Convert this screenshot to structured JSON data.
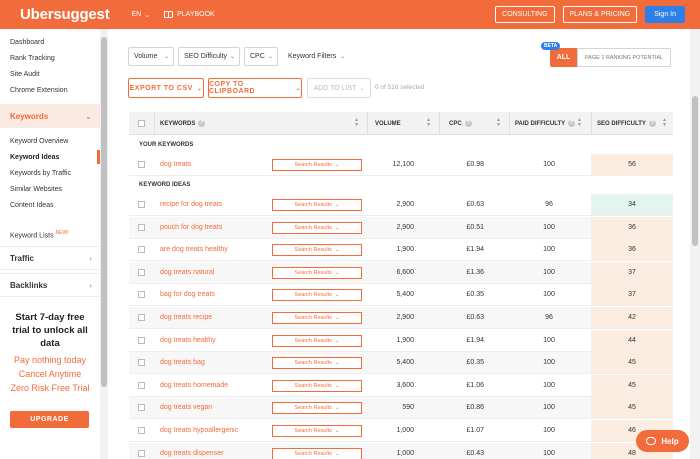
{
  "header": {
    "logo": "Ubersuggest",
    "lang": "EN",
    "playbook": "PLAYBOOK",
    "consulting": "CONSULTING",
    "plans": "PLANS & PRICING",
    "signin": "Sign In"
  },
  "sidebar": {
    "items": [
      "Dashboard",
      "Rank Tracking",
      "Site Audit",
      "Chrome Extension"
    ],
    "keywords_section": "Keywords",
    "sub_items": [
      "Keyword Overview",
      "Keyword Ideas",
      "Keywords by Traffic",
      "Similar Websites",
      "Content Ideas"
    ],
    "keyword_lists": "Keyword Lists",
    "new_tag": "NEW!",
    "traffic": "Traffic",
    "backlinks": "Backlinks",
    "promo_title": "Start 7-day free trial to unlock all data",
    "promo_lines": [
      "Pay nothing today",
      "Cancel Anytime",
      "Zero Risk Free Trial"
    ],
    "upgrade": "UPGRADE"
  },
  "filters": {
    "volume": "Volume",
    "seo_difficulty": "SEO Difficulty",
    "cpc": "CPC",
    "keyword_filters": "Keyword Filters",
    "beta": "BETA",
    "tab_all": "ALL",
    "tab_page1": "PAGE 1 RANKING POTENTIAL"
  },
  "actions": {
    "export": "EXPORT TO CSV",
    "copy": "COPY TO CLIPBOARD",
    "add": "ADD TO LIST",
    "selected": "0 of 516 selected"
  },
  "table": {
    "headers": {
      "keywords": "KEYWORDS",
      "volume": "VOLUME",
      "cpc": "CPC",
      "paid": "PAID DIFFICULTY",
      "seo": "SEO DIFFICULTY"
    },
    "your_keywords_label": "YOUR KEYWORDS",
    "keyword_ideas_label": "KEYWORD IDEAS",
    "search_results_label": "Search Results",
    "your_keywords": [
      {
        "kw": "dog treats",
        "vol": "12,100",
        "cpc": "£0.98",
        "pd": "100",
        "sd": "56"
      }
    ],
    "ideas": [
      {
        "kw": "recipe for dog treats",
        "vol": "2,900",
        "cpc": "£0.63",
        "pd": "96",
        "sd": "34"
      },
      {
        "kw": "pouch for dog treats",
        "vol": "2,900",
        "cpc": "£0.51",
        "pd": "100",
        "sd": "36"
      },
      {
        "kw": "are dog treats healthy",
        "vol": "1,900",
        "cpc": "£1.94",
        "pd": "100",
        "sd": "36"
      },
      {
        "kw": "dog treats natural",
        "vol": "6,600",
        "cpc": "£1.36",
        "pd": "100",
        "sd": "37"
      },
      {
        "kw": "bag for dog treats",
        "vol": "5,400",
        "cpc": "£0.35",
        "pd": "100",
        "sd": "37"
      },
      {
        "kw": "dog treats recipe",
        "vol": "2,900",
        "cpc": "£0.63",
        "pd": "96",
        "sd": "42"
      },
      {
        "kw": "dog treats healthy",
        "vol": "1,900",
        "cpc": "£1.94",
        "pd": "100",
        "sd": "44"
      },
      {
        "kw": "dog treats bag",
        "vol": "5,400",
        "cpc": "£0.35",
        "pd": "100",
        "sd": "45"
      },
      {
        "kw": "dog treats homemade",
        "vol": "3,600",
        "cpc": "£1.06",
        "pd": "100",
        "sd": "45"
      },
      {
        "kw": "dog treats vegan",
        "vol": "590",
        "cpc": "£0.86",
        "pd": "100",
        "sd": "45"
      },
      {
        "kw": "dog treats hypoallergenic",
        "vol": "1,000",
        "cpc": "£1.07",
        "pd": "100",
        "sd": "46"
      },
      {
        "kw": "dog treats dispenser",
        "vol": "1,000",
        "cpc": "£0.43",
        "pd": "100",
        "sd": "48"
      }
    ]
  },
  "help": "Help"
}
